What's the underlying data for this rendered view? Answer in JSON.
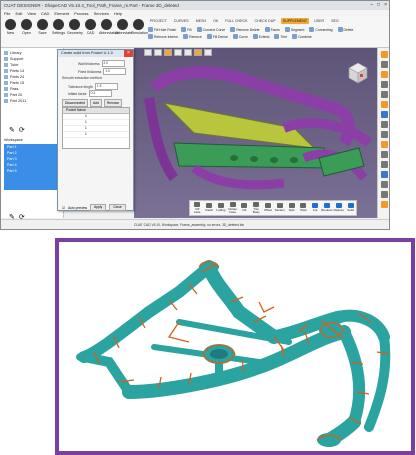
{
  "window": {
    "title": "CUAT DESIGNER - ShapeCAD V5.10.4_Tool_Path_Frame_m.Part - Frame 3D_deleted",
    "controls": [
      "–",
      "□",
      "×"
    ]
  },
  "menu": [
    "File",
    "Edit",
    "View",
    "CAD",
    "Element",
    "Process",
    "Services",
    "Help"
  ],
  "toolbar": {
    "buttons": [
      "New",
      "Open",
      "Save",
      "Settings",
      "Geometry",
      "CAD",
      "Abbreviation",
      "Abbreviate",
      "Simulation"
    ]
  },
  "ribbon_tabs": [
    "PROJECT",
    "CURVES",
    "MESH",
    "OK",
    "FULL CHECK",
    "CHECK DUP",
    "SUPPLEMENT",
    "USER",
    "SEG"
  ],
  "ribbon_active_tab": "SUPPLEMENT",
  "ribbon_items": [
    "Fill Hole Finish",
    "Fill",
    "Connect Curve",
    "Remove Delete",
    "Faces",
    "Segment",
    "Connecting",
    "Delete",
    "Remove Interior",
    "Remove",
    "Fill Dense",
    "Curve",
    "Extend",
    "Trim",
    "Combine"
  ],
  "left_panel": {
    "tree": [
      "Library",
      "Support",
      "Tube",
      "Parts 14",
      "Parts 24",
      "Parts 15",
      "Pass",
      "Part 20",
      "Part 2011"
    ],
    "list_title": "Workspace",
    "list_items": [
      "Part 1",
      "Part 2",
      "Part 3",
      "Part 4",
      "Part 5"
    ]
  },
  "dialog": {
    "title": "Create solid from Pocket U-1.0",
    "fields": [
      {
        "label": "Wall thickness",
        "value": "2.0"
      },
      {
        "label": "Fixed thickness",
        "value": "1.0"
      },
      {
        "label": "Smooth extraction method",
        "value": ""
      },
      {
        "label": "Tolerance length",
        "value": "1.5"
      },
      {
        "label": "Inflate factor",
        "value": "0.4"
      }
    ],
    "buttons": [
      "Disconnected",
      "Add",
      "Remove"
    ],
    "table_header": "Pocket Name",
    "rows": [
      "1",
      "1",
      "1",
      "1"
    ],
    "footer": {
      "checkbox": "Auto preview",
      "apply": "Apply",
      "close": "Close"
    }
  },
  "bottom_palette": [
    "Fill Hole",
    "Patch",
    "Lofting",
    "Delete Face",
    "Fill",
    "Trim Body",
    "Offset",
    "Section",
    "Split",
    "Shell",
    "Cut",
    "Boolean",
    "Reduce",
    "Solid"
  ],
  "status": "CUAT CAD V5.10, Workspace, Frame_assembly, no errors, 3D_deleted.bin",
  "colors": {
    "accent_orange": "#f19a2a",
    "selection_blue": "#3b8ee8",
    "viewport_bg": "#5e5578",
    "frame_border": "#7b3fa1",
    "model_teal": "#2aa3a1",
    "model_edges": "#d2601f"
  }
}
